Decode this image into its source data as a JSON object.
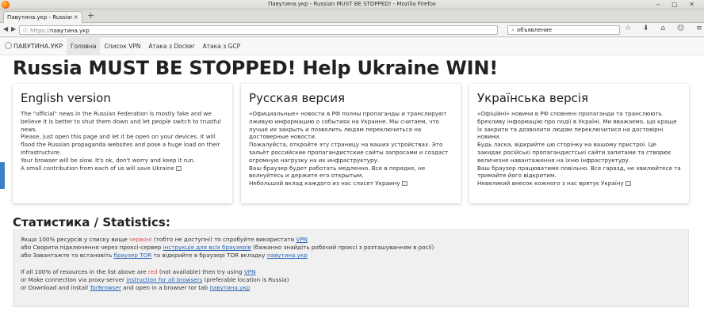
{
  "window": {
    "title": "Павутина.укр - Russian MUST BE STOPPED! - Mozilla Firefox",
    "controls": "‒ ▢ ✕"
  },
  "browser": {
    "tab_title": "Павутина.укр - Russian",
    "new_tab_symbol": "+",
    "url_protocol": "https://",
    "url_host": "павутина.укр",
    "search_value": "объявление",
    "toolbar_icons": "☆ ⬇ ⌂ ☺ ≡"
  },
  "site": {
    "brand": "ПАВУТИНА.УКР",
    "nav": [
      {
        "label": "Головна",
        "active": true
      },
      {
        "label": "Список VPN",
        "active": false
      },
      {
        "label": "Атака з Docker",
        "active": false
      },
      {
        "label": "Атака з GCP",
        "active": false
      }
    ],
    "headline": "Russia MUST BE STOPPED! Help Ukraine WIN!"
  },
  "cards": [
    {
      "title": "English version",
      "paragraphs": [
        "The \"official\" news in the Russian Federation is mostly fake and we believe it is better to shut them down and let people switch to trustful news.",
        "Please, just open this page and let it be open on your devices. It will flood the Russian propaganda websites and pose a huge load on their infrastructure.",
        "Your browser will be slow. It's ok, don't worry and keep it run.",
        "A small contribution from each of us will save Ukraine"
      ]
    },
    {
      "title": "Русская версия",
      "paragraphs": [
        "«Официальные» новости в РФ полны пропаганды и транслируют лживую информацию о событиях на Украине. Мы считаем, что лучше их закрыть и позволить людям переключиться на достоверные новости.",
        "Пожалуйста, откройте эту страницу на ваших устройствах. Это зальёт российские пропагандистские сайты запросами и создаст огромную нагрузку на их инфраструктуру.",
        "Ваш браузер будет работать медленно. Все в порядке, не волнуйтесь и держите его открытым.",
        "Небольшой вклад каждого из нас спасет Украину"
      ]
    },
    {
      "title": "Українська версія",
      "paragraphs": [
        "«Офіційні» новини в РФ сповнені пропаганди та транслюють брехливу інформацію про події в Україні. Ми вважаємо, що краще їх закрити та дозволити людям переключитися на достовірні новини.",
        "Будь ласка, відкрийте цю сторінку на вашому пристрої. Це закидає російські пропагандистські сайти запитами та створює величезне навантаження на їхню інфраструктуру.",
        "Ваш браузер працюватиме повільно. Все гаразд, не хвилюйтеся та тримайте його відкритим.",
        "Невеликий внесок кожного з нас врятує Україну"
      ]
    }
  ],
  "stats": {
    "title": "Статистика / Statistics:",
    "ua": {
      "l1_a": "Якщо 100% ресурсів у списку вище ",
      "l1_red": "червоні",
      "l1_b": " (тобто не доступні) то спробуйте використати ",
      "l1_link": "VPN",
      "l2_a": "або Сворити підключення через проксі-сервер ",
      "l2_link": "інструкція для всіх браузерів",
      "l2_b": " (бажанно знайдіть робочий проксі з розташуванням в росії)",
      "l3_a": "або Завантажте та встановіть ",
      "l3_link": "браузер TOR",
      "l3_b": " та відкрийте в браузері TOR вкладку ",
      "l3_link2": "павутина.укр"
    },
    "en": {
      "l1_a": "If all 100% of resources in the list above are ",
      "l1_red": "red",
      "l1_b": " (not available) then try using ",
      "l1_link": "VPN",
      "l2_a": "or Make connection via proxy-server ",
      "l2_link": "instruction for all browsers",
      "l2_b": " (preferable location is Russia)",
      "l3_a": "or Download and install ",
      "l3_link": "TorBrowser",
      "l3_b": " and open in a browser tor tab ",
      "l3_link2": "павутина.укр"
    }
  },
  "colors": {
    "link": "#2a64b6",
    "red_status": "#d9534f",
    "side_tab": "#3b82c4"
  }
}
